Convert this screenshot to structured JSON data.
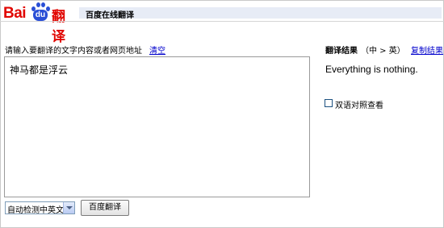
{
  "header": {
    "logo_latin": "Bai",
    "logo_du": "du",
    "logo_cn": "翻译",
    "service_title": "百度在线翻译"
  },
  "input_panel": {
    "prompt": "请输入要翻译的文字内容或者网页地址",
    "clear_label": "清空",
    "source_text": "神马都是浮云",
    "language_select": "自动检测中英文",
    "translate_button": "百度翻译"
  },
  "result_panel": {
    "title": "翻译结果",
    "direction": "（中 > 英）",
    "copy_label": "复制结果",
    "translation": "Everything is nothing.",
    "bilingual_label": "双语对照查看",
    "bilingual_checked": false
  },
  "colors": {
    "brand_red": "#e10601",
    "brand_blue": "#2a4fd6",
    "service_bar": "#e7ecf6",
    "link": "#0000cc"
  },
  "icons": [
    "baidu-paw-icon",
    "dropdown-arrow-icon",
    "checkbox-icon"
  ]
}
